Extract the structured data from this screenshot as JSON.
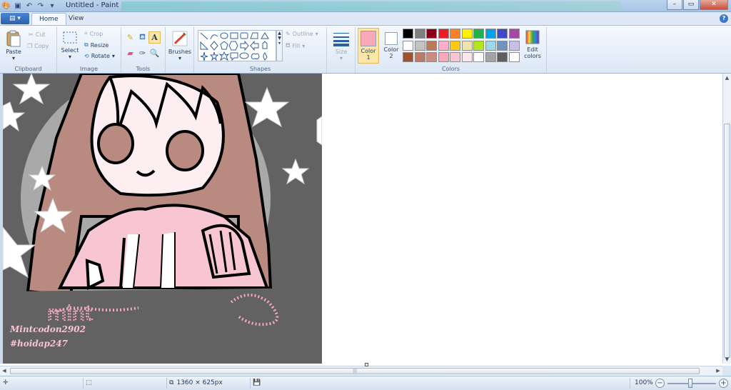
{
  "window": {
    "title": "Untitled - Paint"
  },
  "tabs": {
    "file": "▤ ▾",
    "home": "Home",
    "view": "View"
  },
  "help": "?",
  "clipboard": {
    "paste": "Paste",
    "cut": "Cut",
    "copy": "Copy",
    "group": "Clipboard"
  },
  "image": {
    "select": "Select",
    "crop": "Crop",
    "resize": "Resize",
    "rotate": "Rotate",
    "group": "Image"
  },
  "tools": {
    "group": "Tools"
  },
  "brushes": {
    "label": "Brushes"
  },
  "shapes": {
    "outline": "Outline",
    "fill": "Fill",
    "group": "Shapes"
  },
  "size": {
    "label": "Size"
  },
  "colors": {
    "color1_label": "Color\n1",
    "color2_label": "Color\n2",
    "color1_value": "#f9a7b9",
    "color2_value": "#ffffff",
    "edit_label": "Edit\ncolors",
    "group": "Colors",
    "palette_row1": [
      "#000000",
      "#7f7f7f",
      "#880015",
      "#ed1c24",
      "#ff7f27",
      "#fff200",
      "#22b14c",
      "#00a2e8",
      "#3f48cc",
      "#a349a4"
    ],
    "palette_row2": [
      "#ffffff",
      "#c3c3c3",
      "#b97a57",
      "#ffaec9",
      "#ffc90e",
      "#efe4b0",
      "#b5e61d",
      "#99d9ea",
      "#7092be",
      "#c8bfe7"
    ],
    "palette_row3": [
      "#a0522d",
      "#b97a6a",
      "#c98c7e",
      "#f9a7b9",
      "#fbc4d1",
      "#fde6ea",
      "#ffffff",
      "#a3a3a3",
      "#5f5f5f",
      "#ffffff"
    ]
  },
  "artwork": {
    "signature_line1": "Mintcodon2902",
    "signature_line2": "#hoidap247",
    "handwriting": "mint"
  },
  "status": {
    "dimensions": "1360 × 625px",
    "zoom": "100%"
  }
}
